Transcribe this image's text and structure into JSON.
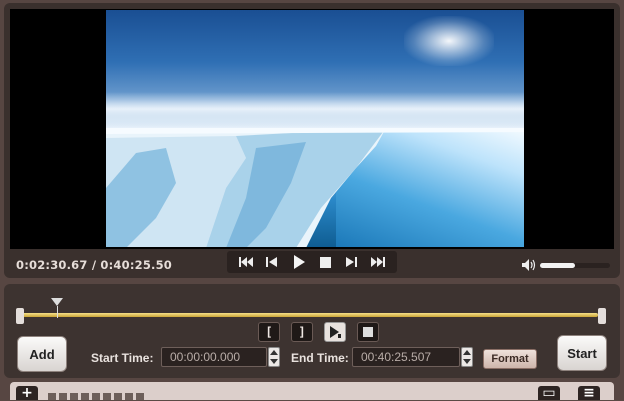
{
  "player": {
    "current_time": "0:02:30.67",
    "total_time": "0:40:25.50",
    "volume_fraction": 0.5
  },
  "transport": {
    "icons": [
      "skip-to-start-icon",
      "step-back-icon",
      "play-icon",
      "stop-icon",
      "step-forward-icon",
      "skip-to-end-icon"
    ]
  },
  "trim": {
    "playhead_fraction": 0.06,
    "mark_buttons": {
      "mark_in": "[",
      "mark_out": "]"
    },
    "start_label": "Start Time:",
    "start_value": "00:00:00.000",
    "end_label": "End Time:",
    "end_value": "00:40:25.507",
    "format_label": "Format"
  },
  "actions": {
    "add_label": "Add",
    "start_label": "Start"
  },
  "colors": {
    "background": "#574642",
    "timeline": "#d9b84a",
    "panel": "#3d3330"
  }
}
